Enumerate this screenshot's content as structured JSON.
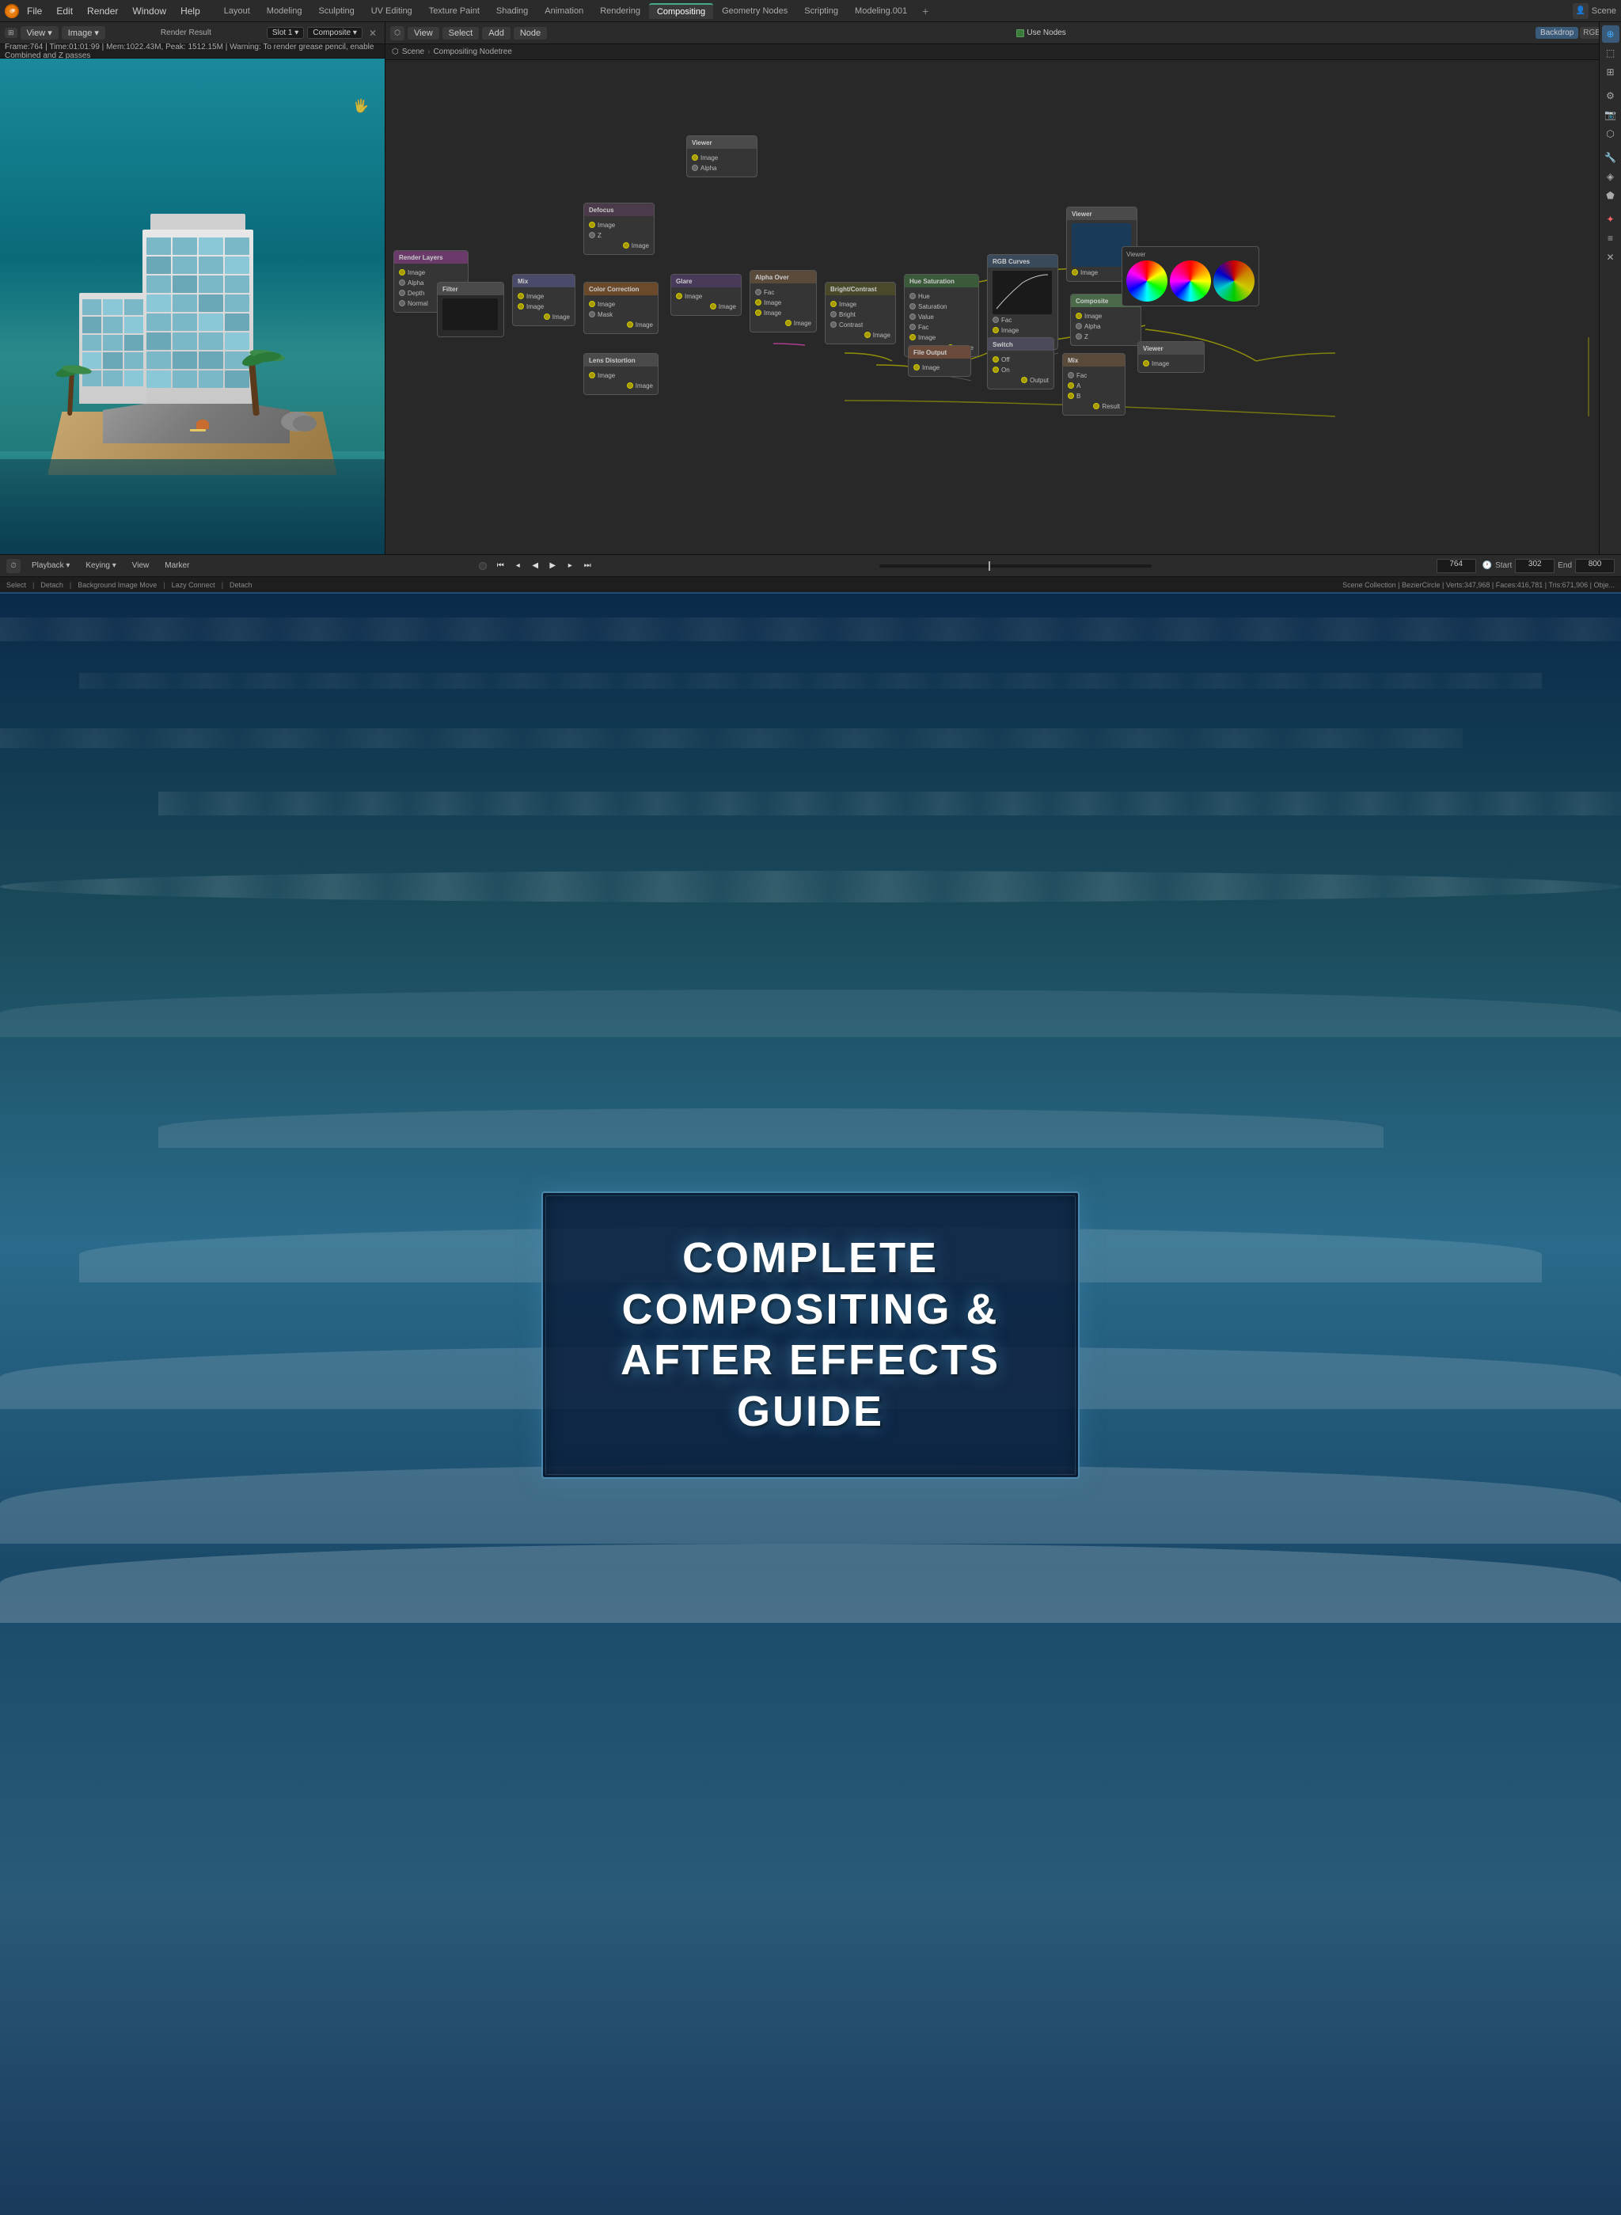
{
  "app": {
    "title": "Blender",
    "logo": "⬡"
  },
  "menubar": {
    "items": [
      "File",
      "Edit",
      "Render",
      "Window",
      "Help"
    ],
    "workspaces": [
      "Layout",
      "Modeling",
      "Sculpting",
      "UV Editing",
      "Texture Paint",
      "Shading",
      "Animation",
      "Rendering",
      "Compositing",
      "Geometry Nodes",
      "Scripting",
      "Modeling.001"
    ],
    "active_workspace": "Compositing",
    "plus_label": "+"
  },
  "render_panel": {
    "toolbar": {
      "view_label": "View",
      "image_label": "Image",
      "render_result": "Render Result",
      "slot_label": "Slot 1",
      "composite_label": "Composite"
    },
    "info": {
      "frame": "Frame:764",
      "time": "Time:01:01:99",
      "mem": "Mem:1022.43M, Peak: 1512.15M",
      "warning": "Warning: To render grease pencil, enable Combined and Z passes"
    }
  },
  "node_panel": {
    "toolbar": {
      "view_label": "View",
      "select_label": "Select",
      "add_label": "Add",
      "node_label": "Node",
      "use_nodes_label": "Use Nodes",
      "backdrop_label": "Backdrop"
    },
    "breadcrumb": [
      "Scene",
      "Compositing Nodetree"
    ]
  },
  "timeline": {
    "playback_label": "Playback",
    "keying_label": "Keying",
    "view_label": "View",
    "marker_label": "Marker",
    "frame": "764",
    "start_label": "Start",
    "start_value": "302",
    "end_label": "End",
    "end_value": "800"
  },
  "status_bar": {
    "select_label": "Select",
    "detach_label": "Detach",
    "bg_image_label": "Background Image Move",
    "lazy_connect_label": "Lazy Connect",
    "detach2_label": "Detach",
    "scene_info": "Scene Collection | BezierCircle | Verts:347,968 | Faces:416,781 | Tris:671,906 | Obje..."
  },
  "title_card": {
    "line1": "COMPLETE COMPOSITING &",
    "line2": "AFTER EFFECTS GUIDE"
  },
  "colors": {
    "accent_blue": "#4a8ab0",
    "active_workspace_color": "#4a8a40",
    "node_yellow": "#cccc00",
    "node_pink": "#cc66aa"
  }
}
